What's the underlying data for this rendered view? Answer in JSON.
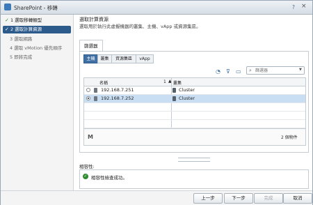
{
  "window": {
    "title": "SharePoint - 移轉",
    "help": "?",
    "close": "×"
  },
  "steps": [
    {
      "num": "1",
      "label": "選取移轉類型",
      "state": "done"
    },
    {
      "num": "2",
      "label": "選取計算資源",
      "state": "active"
    },
    {
      "num": "3",
      "label": "選取網路",
      "state": "future"
    },
    {
      "num": "4",
      "label": "選取 vMotion 優先順序",
      "state": "future"
    },
    {
      "num": "5",
      "label": "即將完成",
      "state": "future"
    }
  ],
  "page": {
    "title": "選取計算資源",
    "subtitle": "選取用於執行此虛擬機器的叢集、主機、vApp 或資源集區。"
  },
  "filter_tab": "篩選器",
  "subtabs": [
    "主機",
    "叢集",
    "資源集區",
    "vApp"
  ],
  "filter": {
    "placeholder": "篩選器"
  },
  "table": {
    "columns": [
      "名稱",
      "叢集"
    ],
    "sort_index": "1",
    "rows": [
      {
        "name": "192.168.7.251",
        "cluster": "Cluster",
        "selected": false
      },
      {
        "name": "192.168.7.252",
        "cluster": "Cluster",
        "selected": true
      }
    ],
    "count": "2 個物件"
  },
  "compatibility": {
    "label": "相容性:",
    "message": "相容性檢查成功。"
  },
  "buttons": {
    "back": "上一步",
    "next": "下一步",
    "finish": "完成",
    "cancel": "取消"
  },
  "colors": {
    "accent": "#2d5b8c",
    "selected_row": "#c9def3",
    "success": "#2e8b2e"
  }
}
